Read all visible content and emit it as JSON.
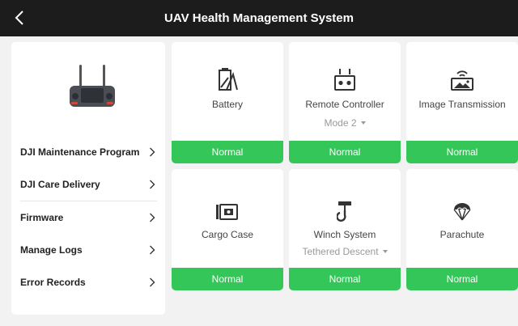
{
  "header": {
    "title": "UAV Health Management System"
  },
  "colors": {
    "topbar": "#1c1c1c",
    "status_ok": "#35c659",
    "background": "#f2f2f2"
  },
  "sidebar": {
    "items": [
      {
        "label": "DJI Maintenance Program"
      },
      {
        "label": "DJI Care Delivery"
      },
      {
        "label": "Firmware"
      },
      {
        "label": "Manage Logs"
      },
      {
        "label": "Error Records"
      }
    ]
  },
  "modules": [
    {
      "name": "Battery",
      "icon": "battery-icon",
      "status": "Normal"
    },
    {
      "name": "Remote Controller",
      "icon": "remote-controller-icon",
      "mode": "Mode 2",
      "status": "Normal"
    },
    {
      "name": "Image Transmission",
      "icon": "image-transmission-icon",
      "status": "Normal"
    },
    {
      "name": "Cargo Case",
      "icon": "cargo-case-icon",
      "status": "Normal"
    },
    {
      "name": "Winch System",
      "icon": "winch-icon",
      "mode": "Tethered Descent",
      "status": "Normal"
    },
    {
      "name": "Parachute",
      "icon": "parachute-icon",
      "status": "Normal"
    }
  ]
}
